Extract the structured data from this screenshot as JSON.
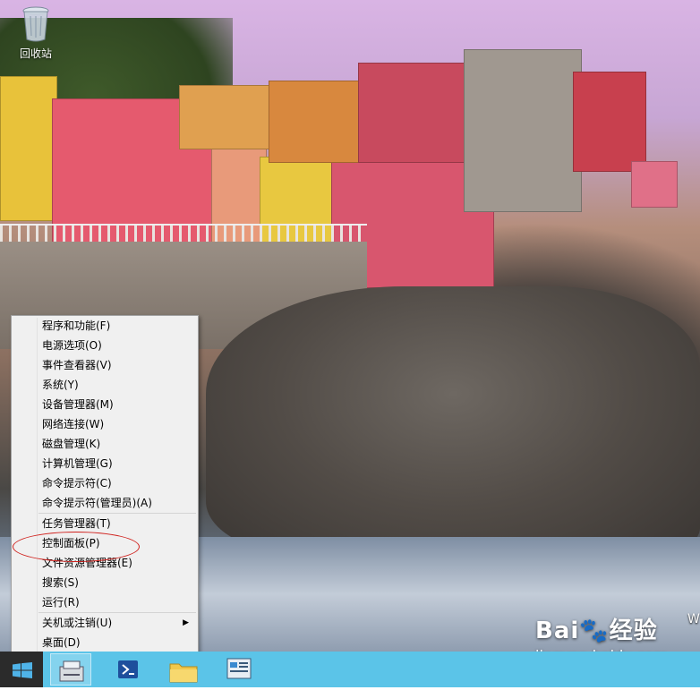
{
  "desktop": {
    "recycle_bin_label": "回收站",
    "watermark_partial": "W"
  },
  "menu": {
    "group1": [
      {
        "label": "程序和功能(F)",
        "name": "menu-programs-features"
      },
      {
        "label": "电源选项(O)",
        "name": "menu-power-options"
      },
      {
        "label": "事件查看器(V)",
        "name": "menu-event-viewer"
      },
      {
        "label": "系统(Y)",
        "name": "menu-system"
      },
      {
        "label": "设备管理器(M)",
        "name": "menu-device-manager"
      },
      {
        "label": "网络连接(W)",
        "name": "menu-network-connections"
      },
      {
        "label": "磁盘管理(K)",
        "name": "menu-disk-management"
      },
      {
        "label": "计算机管理(G)",
        "name": "menu-computer-management"
      },
      {
        "label": "命令提示符(C)",
        "name": "menu-command-prompt"
      },
      {
        "label": "命令提示符(管理员)(A)",
        "name": "menu-command-prompt-admin"
      }
    ],
    "group2": [
      {
        "label": "任务管理器(T)",
        "name": "menu-task-manager"
      },
      {
        "label": "控制面板(P)",
        "name": "menu-control-panel"
      },
      {
        "label": "文件资源管理器(E)",
        "name": "menu-file-explorer"
      },
      {
        "label": "搜索(S)",
        "name": "menu-search"
      },
      {
        "label": "运行(R)",
        "name": "menu-run"
      }
    ],
    "group3": [
      {
        "label": "关机或注销(U)",
        "name": "menu-shutdown-signout"
      },
      {
        "label": "桌面(D)",
        "name": "menu-desktop"
      }
    ]
  },
  "taskbar": {
    "accent_color": "#5bc4e8",
    "start_color": "#2b2b2b",
    "buttons": [
      "server-manager-icon",
      "powershell-icon",
      "file-explorer-icon",
      "control-panel-icon"
    ]
  },
  "watermark": {
    "logo": "Bai🐾经验",
    "url": "jingyan.baidu.com"
  },
  "highlight_color": "#d0221e"
}
